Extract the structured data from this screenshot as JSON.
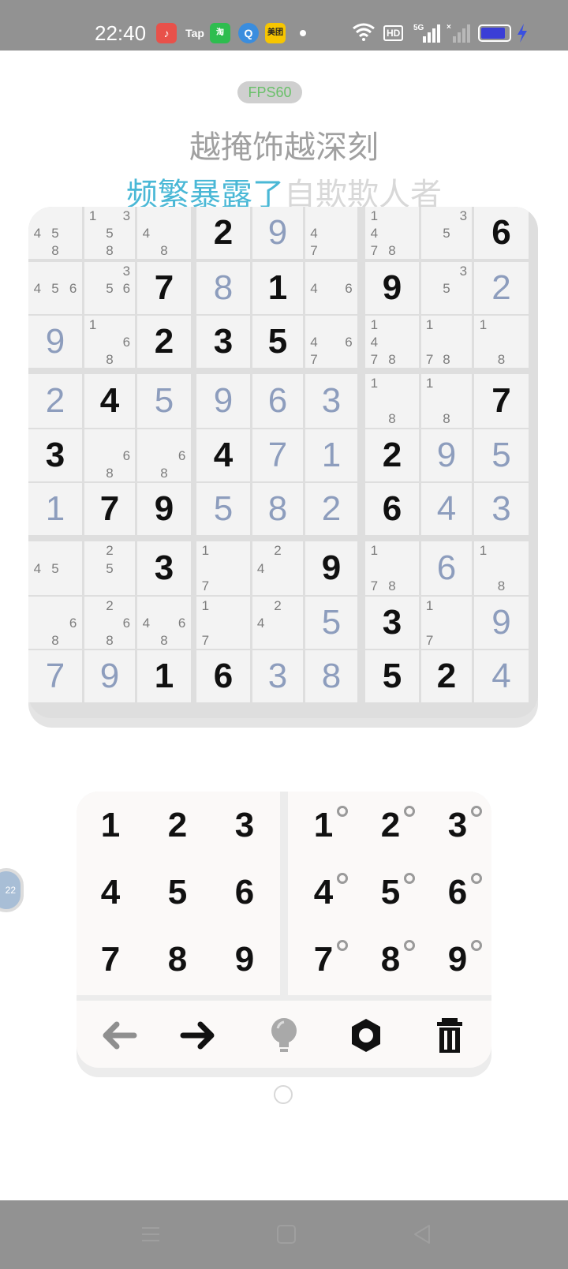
{
  "status_bar": {
    "time": "22:40",
    "apps": [
      {
        "name": "music-app-icon",
        "label": "♪"
      },
      {
        "name": "tap-app-icon",
        "label": "Tap"
      },
      {
        "name": "shop-app-icon",
        "label": "淘"
      },
      {
        "name": "qq-app-icon",
        "label": "Q"
      },
      {
        "name": "meituan-app-icon",
        "label": "美团"
      }
    ],
    "hd_label": "HD",
    "network_label": "5G",
    "battery_color": "#3a3ed6"
  },
  "fps_label": "FPS60",
  "lyrics": {
    "line1": "越掩饰越深刻",
    "line2_highlight": "频繁暴露了",
    "line2_rest": "自欺欺人者"
  },
  "colors": {
    "given_digit": "#101010",
    "user_digit": "#8d9dbd",
    "lyric_highlight": "#4ab8d6"
  },
  "board": {
    "rows": [
      [
        {
          "notes": [
            4,
            5,
            8
          ]
        },
        {
          "notes": [
            1,
            3,
            5,
            8
          ]
        },
        {
          "notes": [
            4,
            8
          ]
        },
        {
          "v": 2,
          "t": "g"
        },
        {
          "v": 9,
          "t": "u"
        },
        {
          "notes": [
            4,
            7
          ]
        },
        {
          "notes": [
            1,
            4,
            7,
            8
          ]
        },
        {
          "notes": [
            3,
            5
          ]
        },
        {
          "v": 6,
          "t": "g"
        }
      ],
      [
        {
          "notes": [
            4,
            5,
            6
          ]
        },
        {
          "notes": [
            3,
            5,
            6
          ]
        },
        {
          "v": 7,
          "t": "g"
        },
        {
          "v": 8,
          "t": "u"
        },
        {
          "v": 1,
          "t": "g"
        },
        {
          "notes": [
            4,
            6
          ]
        },
        {
          "v": 9,
          "t": "g"
        },
        {
          "notes": [
            3,
            5
          ]
        },
        {
          "v": 2,
          "t": "u"
        }
      ],
      [
        {
          "v": 9,
          "t": "u"
        },
        {
          "notes": [
            1,
            6,
            8
          ]
        },
        {
          "v": 2,
          "t": "g"
        },
        {
          "v": 3,
          "t": "g"
        },
        {
          "v": 5,
          "t": "g"
        },
        {
          "notes": [
            4,
            6,
            7
          ]
        },
        {
          "notes": [
            1,
            4,
            7,
            8
          ]
        },
        {
          "notes": [
            1,
            7,
            8
          ]
        },
        {
          "notes": [
            1,
            8
          ]
        }
      ],
      [
        {
          "v": 2,
          "t": "u"
        },
        {
          "v": 4,
          "t": "g"
        },
        {
          "v": 5,
          "t": "u"
        },
        {
          "v": 9,
          "t": "u"
        },
        {
          "v": 6,
          "t": "u"
        },
        {
          "v": 3,
          "t": "u"
        },
        {
          "notes": [
            1,
            8
          ]
        },
        {
          "notes": [
            1,
            8
          ]
        },
        {
          "v": 7,
          "t": "g"
        }
      ],
      [
        {
          "v": 3,
          "t": "g"
        },
        {
          "notes": [
            6,
            8
          ]
        },
        {
          "notes": [
            6,
            8
          ]
        },
        {
          "v": 4,
          "t": "g"
        },
        {
          "v": 7,
          "t": "u"
        },
        {
          "v": 1,
          "t": "u"
        },
        {
          "v": 2,
          "t": "g"
        },
        {
          "v": 9,
          "t": "u"
        },
        {
          "v": 5,
          "t": "u"
        }
      ],
      [
        {
          "v": 1,
          "t": "u"
        },
        {
          "v": 7,
          "t": "g"
        },
        {
          "v": 9,
          "t": "g"
        },
        {
          "v": 5,
          "t": "u"
        },
        {
          "v": 8,
          "t": "u"
        },
        {
          "v": 2,
          "t": "u"
        },
        {
          "v": 6,
          "t": "g"
        },
        {
          "v": 4,
          "t": "u"
        },
        {
          "v": 3,
          "t": "u"
        }
      ],
      [
        {
          "notes": [
            4,
            5
          ]
        },
        {
          "notes": [
            2,
            5
          ]
        },
        {
          "v": 3,
          "t": "g"
        },
        {
          "notes": [
            1,
            7
          ]
        },
        {
          "notes": [
            2,
            4
          ]
        },
        {
          "v": 9,
          "t": "g"
        },
        {
          "notes": [
            1,
            7,
            8
          ]
        },
        {
          "v": 6,
          "t": "u"
        },
        {
          "notes": [
            1,
            8
          ]
        }
      ],
      [
        {
          "notes": [
            6,
            8
          ]
        },
        {
          "notes": [
            2,
            6,
            8
          ]
        },
        {
          "notes": [
            4,
            6,
            8
          ]
        },
        {
          "notes": [
            1,
            7
          ]
        },
        {
          "notes": [
            2,
            4
          ]
        },
        {
          "v": 5,
          "t": "u"
        },
        {
          "v": 3,
          "t": "g"
        },
        {
          "notes": [
            1,
            7
          ]
        },
        {
          "v": 9,
          "t": "u"
        }
      ],
      [
        {
          "v": 7,
          "t": "u"
        },
        {
          "v": 9,
          "t": "u"
        },
        {
          "v": 1,
          "t": "g"
        },
        {
          "v": 6,
          "t": "g"
        },
        {
          "v": 3,
          "t": "u"
        },
        {
          "v": 8,
          "t": "u"
        },
        {
          "v": 5,
          "t": "g"
        },
        {
          "v": 2,
          "t": "g"
        },
        {
          "v": 4,
          "t": "u"
        }
      ]
    ]
  },
  "keypad": {
    "digits": [
      "1",
      "2",
      "3",
      "4",
      "5",
      "6",
      "7",
      "8",
      "9"
    ],
    "note_digits": [
      "1",
      "2",
      "3",
      "4",
      "5",
      "6",
      "7",
      "8",
      "9"
    ],
    "tools": [
      "undo-arrow-icon",
      "redo-arrow-icon",
      "hint-bulb-icon",
      "settings-gear-icon",
      "delete-trash-icon"
    ]
  },
  "side_bubble_label": "22"
}
